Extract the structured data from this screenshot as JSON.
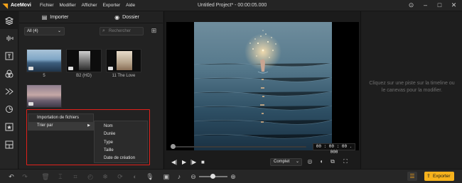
{
  "app": {
    "name": "AceMovi",
    "window_title": "Untitled Project* - 00:00:05.000",
    "brand_color": "#f7b21c"
  },
  "menu": [
    "Fichier",
    "Modifier",
    "Afficher",
    "Exporter",
    "Aide"
  ],
  "sidebar_tools": [
    "media-icon",
    "audio-icon",
    "text-icon",
    "filters-icon",
    "transitions-icon",
    "effects-icon",
    "elements-icon",
    "split-screen-icon"
  ],
  "media": {
    "import_label": "Importer",
    "folder_label": "Dossier",
    "filter_value": "All (4)",
    "search_placeholder": "Rechercher",
    "items": [
      {
        "label": "5"
      },
      {
        "label": "B2 (HD)"
      },
      {
        "label": "11 The Love"
      },
      {
        "label": ""
      }
    ]
  },
  "context_menu": {
    "items": [
      "Importation de fichiers",
      "Trier par"
    ],
    "sort_options": [
      "Nom",
      "Durée",
      "Type",
      "Taille",
      "Date de création"
    ]
  },
  "preview": {
    "timecode": "00 : 00 : 00 . 000",
    "quality": "Complet"
  },
  "properties": {
    "hint": "Cliquez sur une piste sur la timeline ou le canevas pour la modifier."
  },
  "bottom": {
    "export_label": "Exporter"
  }
}
